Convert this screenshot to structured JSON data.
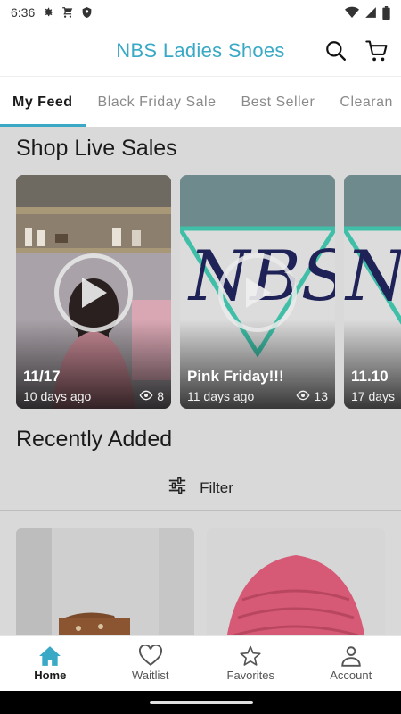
{
  "status_bar": {
    "time": "6:36",
    "icons_left": [
      "gear-icon",
      "cart-icon",
      "shield-icon"
    ],
    "icons_right": [
      "wifi-icon",
      "signal-icon",
      "battery-icon"
    ]
  },
  "header": {
    "title": "NBS Ladies Shoes",
    "title_color": "#39a9c6",
    "icons": [
      "search-icon",
      "cart-icon"
    ]
  },
  "tabs": [
    {
      "label": "My Feed",
      "active": true
    },
    {
      "label": "Black Friday Sale",
      "active": false
    },
    {
      "label": "Best Seller",
      "active": false
    },
    {
      "label": "Clearan",
      "active": false
    }
  ],
  "live_section": {
    "title": "Shop Live Sales",
    "cards": [
      {
        "title": "11/17",
        "time": "10 days ago",
        "views": "8",
        "has_play": true
      },
      {
        "title": "Pink Friday!!!",
        "time": "11 days ago",
        "views": "13",
        "has_play": true
      },
      {
        "title": "11.10",
        "time": "17 days",
        "views": "",
        "has_play": false
      }
    ]
  },
  "recent_section": {
    "title": "Recently Added",
    "filter_label": "Filter"
  },
  "bottom_nav": [
    {
      "label": "Home",
      "icon": "home-icon",
      "active": true
    },
    {
      "label": "Waitlist",
      "icon": "heart-icon",
      "active": false
    },
    {
      "label": "Favorites",
      "icon": "star-icon",
      "active": false
    },
    {
      "label": "Account",
      "icon": "person-icon",
      "active": false
    }
  ],
  "colors": {
    "accent": "#39a9c6",
    "overlay": "#d9d9d9",
    "nbs_navy": "#1f2257",
    "nbs_teal": "#3fbfa7"
  }
}
